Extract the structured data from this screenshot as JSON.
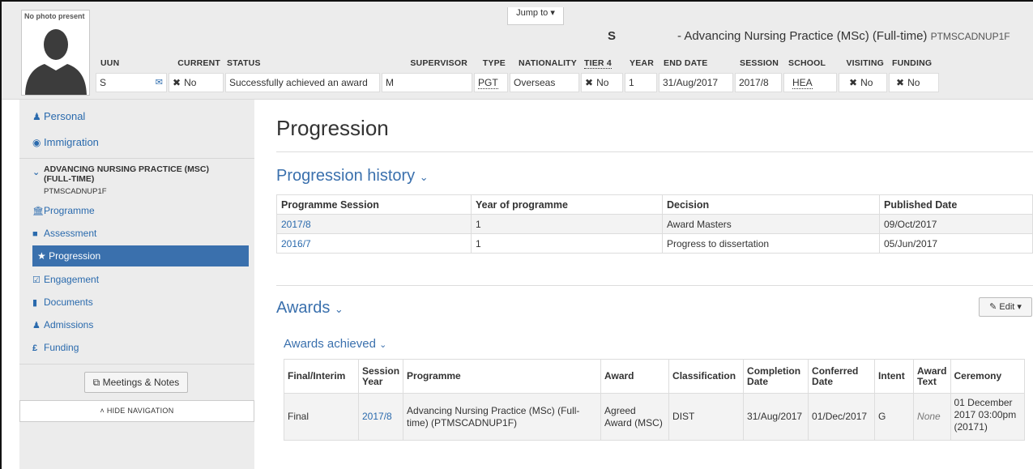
{
  "header": {
    "photo_label": "No photo present",
    "jump_to": "Jump to ▾",
    "student_name": "S",
    "programme_title": "- Advancing Nursing Practice (MSc) (Full-time)",
    "programme_code": "PTMSCADNUP1F",
    "fields": {
      "uun": {
        "label": "UUN",
        "value": "S"
      },
      "current": {
        "label": "CURRENT",
        "value": "No"
      },
      "status": {
        "label": "STATUS",
        "value": "Successfully achieved an award"
      },
      "supervisor": {
        "label": "SUPERVISOR",
        "value": "M"
      },
      "type": {
        "label": "TYPE",
        "value": "PGT"
      },
      "nationality": {
        "label": "NATIONALITY",
        "value": "Overseas"
      },
      "tier4": {
        "label": "TIER 4",
        "value": "No"
      },
      "year": {
        "label": "YEAR",
        "value": "1"
      },
      "end_date": {
        "label": "END DATE",
        "value": "31/Aug/2017"
      },
      "session": {
        "label": "SESSION",
        "value": "2017/8"
      },
      "school": {
        "label": "SCHOOL",
        "value": "HEA"
      },
      "visiting": {
        "label": "VISITING",
        "value": "No"
      },
      "funding": {
        "label": "FUNDING",
        "value": "No"
      }
    }
  },
  "sidebar": {
    "personal": "Personal",
    "immigration": "Immigration",
    "programme_heading": "ADVANCING NURSING PRACTICE (MSC) (FULL-TIME)",
    "programme_code": "PTMSCADNUP1F",
    "items": [
      {
        "label": "Programme"
      },
      {
        "label": "Assessment"
      },
      {
        "label": "Progression"
      },
      {
        "label": "Engagement"
      },
      {
        "label": "Documents"
      },
      {
        "label": "Admissions"
      },
      {
        "label": "Funding"
      }
    ],
    "meetings_button": "Meetings & Notes",
    "hide_nav": "HIDE NAVIGATION"
  },
  "main": {
    "title": "Progression",
    "progression_history": {
      "heading": "Progression history",
      "columns": [
        "Programme Session",
        "Year of programme",
        "Decision",
        "Published Date"
      ],
      "rows": [
        [
          "2017/8",
          "1",
          "Award Masters",
          "09/Oct/2017"
        ],
        [
          "2016/7",
          "1",
          "Progress to dissertation",
          "05/Jun/2017"
        ]
      ]
    },
    "awards": {
      "heading": "Awards",
      "edit_button": "Edit",
      "sub_heading": "Awards achieved",
      "columns": [
        "Final/Interim",
        "Session Year",
        "Programme",
        "Award",
        "Classification",
        "Completion Date",
        "Conferred Date",
        "Intent",
        "Award Text",
        "Ceremony"
      ],
      "rows": [
        [
          "Final",
          "2017/8",
          "Advancing Nursing Practice (MSc) (Full-time) (PTMSCADNUP1F)",
          "Agreed Award (MSC)",
          "DIST",
          "31/Aug/2017",
          "01/Dec/2017",
          "G",
          "None",
          "01 December 2017 03:00pm (20171)"
        ]
      ]
    }
  },
  "colors": {
    "link": "#2a6aad",
    "active_nav": "#3a70ad",
    "header_bg": "#ececec"
  }
}
